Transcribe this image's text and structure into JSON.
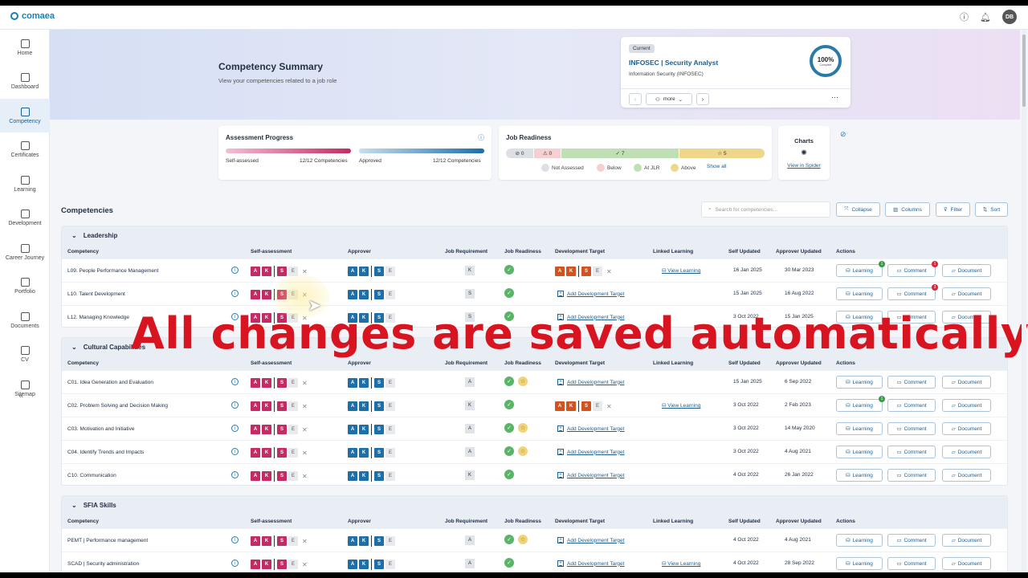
{
  "app": {
    "logo": "comaea",
    "avatar": "DB"
  },
  "sidebar": {
    "items": [
      {
        "label": "Home",
        "icon": "home-icon"
      },
      {
        "label": "Dashboard",
        "icon": "dashboard-icon"
      },
      {
        "label": "Competency",
        "icon": "competency-icon",
        "active": true
      },
      {
        "label": "Certificates",
        "icon": "certificates-icon"
      },
      {
        "label": "Learning",
        "icon": "learning-icon"
      },
      {
        "label": "Development",
        "icon": "development-icon"
      },
      {
        "label": "Career Journey",
        "icon": "career-icon"
      },
      {
        "label": "Portfolio",
        "icon": "portfolio-icon"
      },
      {
        "label": "Documents",
        "icon": "documents-icon"
      },
      {
        "label": "CV",
        "icon": "cv-icon"
      },
      {
        "label": "Sitemap",
        "icon": "sitemap-icon"
      }
    ]
  },
  "hero": {
    "title": "Competency Summary",
    "subtitle": "View your competencies related to a job role"
  },
  "role_card": {
    "pill": "Current",
    "title": "INFOSEC | Security Analyst",
    "subtitle": "Information Security (INFOSEC)",
    "percent": "100%",
    "complete_label": "Complete",
    "more_label": "more"
  },
  "assessment": {
    "title": "Assessment Progress",
    "self_label": "Self-assessed",
    "self_value": "12/12 Competencies",
    "approved_label": "Approved",
    "approved_value": "12/12 Competencies",
    "self_fraction": 1.0,
    "approved_fraction": 1.0
  },
  "job_readiness": {
    "title": "Job Readiness",
    "not_assessed": "0",
    "below": "0",
    "at": "7",
    "above": "5",
    "legend": {
      "not_assessed": "Not Assessed",
      "below": "Below",
      "at": "At JLR",
      "above": "Above",
      "show_all": "Show all"
    }
  },
  "charts": {
    "title": "Charts",
    "link": "View in Spider"
  },
  "toolbar": {
    "heading": "Competencies",
    "search_placeholder": "Search for competencies...",
    "collapse": "Collapse",
    "columns": "Columns",
    "filter": "Filter",
    "sort": "Sort"
  },
  "columns": {
    "competency": "Competency",
    "self": "Self-assessment",
    "approver": "Approver",
    "job_req": "Job Requirement",
    "job_ready": "Job Readiness",
    "dev_target": "Development Target",
    "linked": "Linked Learning",
    "self_updated": "Self Updated",
    "approver_updated": "Approver Updated",
    "actions": "Actions"
  },
  "labels": {
    "add_dev_target": "Add Development Target",
    "view_learning": "View Learning",
    "learning": "Learning",
    "comment": "Comment",
    "document": "Document",
    "chip_a": "A",
    "chip_k": "K",
    "chip_s": "S",
    "chip_e": "E"
  },
  "sections": [
    {
      "title": "Leadership",
      "rows": [
        {
          "name": "L09. People Performance Management",
          "req": "K",
          "star": false,
          "dev": "chips",
          "linked": true,
          "self_updated": "16 Jan 2025",
          "approver_updated": "30 Mar 2023",
          "learning_badge": "1",
          "comment_badge": "1"
        },
        {
          "name": "L10. Talent Development",
          "req": "S",
          "star": false,
          "dev": "add",
          "linked": false,
          "self_updated": "15 Jan 2025",
          "approver_updated": "16 Aug 2022",
          "learning_badge": "",
          "comment_badge": "3"
        },
        {
          "name": "L12. Managing Knowledge",
          "req": "S",
          "star": false,
          "dev": "add",
          "linked": false,
          "self_updated": "3 Oct 2022",
          "approver_updated": "15 Jan 2025",
          "learning_badge": "",
          "comment_badge": ""
        }
      ]
    },
    {
      "title": "Cultural Capabilities",
      "rows": [
        {
          "name": "C01. Idea Generation and Evaluation",
          "req": "A",
          "star": true,
          "dev": "add",
          "linked": false,
          "self_updated": "15 Jan 2025",
          "approver_updated": "6 Sep 2022",
          "learning_badge": "",
          "comment_badge": ""
        },
        {
          "name": "C02. Problem Solving and Decision Making",
          "req": "K",
          "star": false,
          "dev": "chips",
          "linked": true,
          "self_updated": "3 Oct 2022",
          "approver_updated": "2 Feb 2023",
          "learning_badge": "1",
          "comment_badge": ""
        },
        {
          "name": "C03. Motivation and Initiative",
          "req": "A",
          "star": true,
          "dev": "add",
          "linked": false,
          "self_updated": "3 Oct 2022",
          "approver_updated": "14 May 2020",
          "learning_badge": "",
          "comment_badge": ""
        },
        {
          "name": "C04. Identify Trends and Impacts",
          "req": "A",
          "star": true,
          "dev": "add",
          "linked": false,
          "self_updated": "3 Oct 2022",
          "approver_updated": "4 Aug 2021",
          "learning_badge": "",
          "comment_badge": ""
        },
        {
          "name": "C10. Communication",
          "req": "K",
          "star": false,
          "dev": "add",
          "linked": false,
          "self_updated": "4 Oct 2022",
          "approver_updated": "26 Jan 2022",
          "learning_badge": "",
          "comment_badge": ""
        }
      ]
    },
    {
      "title": "SFIA Skills",
      "rows": [
        {
          "name": "PEMT | Performance management",
          "req": "A",
          "star": true,
          "dev": "add",
          "linked": false,
          "self_updated": "4 Oct 2022",
          "approver_updated": "4 Aug 2021",
          "learning_badge": "",
          "comment_badge": ""
        },
        {
          "name": "SCAD | Security administration",
          "req": "A",
          "star": false,
          "dev": "add",
          "linked": true,
          "self_updated": "4 Oct 2022",
          "approver_updated": "28 Sep 2022",
          "learning_badge": "",
          "comment_badge": ""
        }
      ]
    }
  ],
  "overlay_caption": "All changes are saved automatically",
  "colors": {
    "accent": "#1d5e8c",
    "self_chip": "#c42a64",
    "approver_chip": "#1e6ea7",
    "dev_chip": "#d2531f",
    "caption": "#d7141f"
  }
}
